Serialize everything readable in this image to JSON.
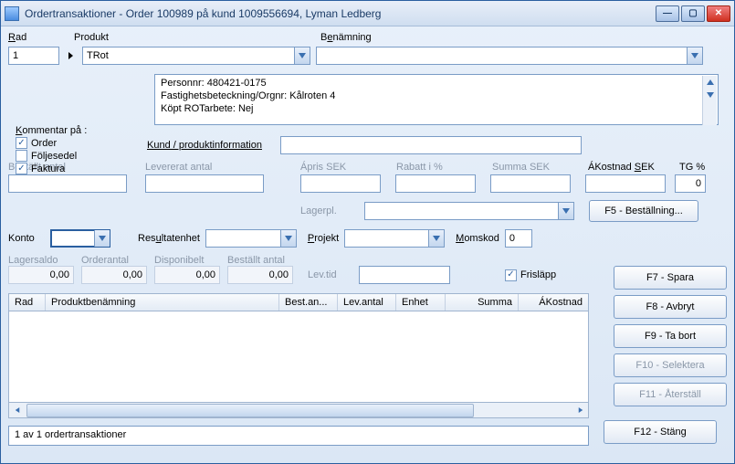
{
  "titlebar": {
    "title": "Ordertransaktioner - Order 100989 på kund 1009556694, Lyman Ledberg"
  },
  "labels": {
    "rad": "Rad",
    "produkt": "Produkt",
    "benamning": "Benämning",
    "kommentar": "Kommentar på :",
    "order": "Order",
    "foljesedel": "Följesedel",
    "faktura": "Faktura",
    "kund_info": "Kund / produktinformation",
    "bestallt_antal": "Beställt antal",
    "levererat_antal": "Levererat antal",
    "apris": "Ápris SEK",
    "rabatt": "Rabatt i %",
    "summa": "Summa SEK",
    "akostnad": "ÁKostnad SEK",
    "tg": "TG %",
    "lagerpl": "Lagerpl.",
    "konto": "Konto",
    "resultatenhet": "Resultatenhet",
    "projekt": "Projekt",
    "momskod": "Momskod",
    "lagersaldo": "Lagersaldo",
    "orderantal": "Orderantal",
    "disponibelt": "Disponibelt",
    "bestallt_antal2": "Beställt antal",
    "levtid": "Lev.tid",
    "frislapp": "Frisläpp"
  },
  "values": {
    "rad": "1",
    "produkt": "TRot",
    "benamning": "",
    "tg": "0",
    "momskod": "0",
    "lagersaldo": "0,00",
    "orderantal": "0,00",
    "disponibelt": "0,00",
    "bestallt_antal2": "0,00"
  },
  "info": {
    "l1": "Personnr: 480421-0175",
    "l2": "Fastighetsbeteckning/Orgnr: Kålroten 4",
    "l3": "Köpt ROTarbete: Nej"
  },
  "buttons": {
    "f5": "F5 - Beställning...",
    "f7": "F7 - Spara",
    "f8": "F8 - Avbryt",
    "f9": "F9 - Ta bort",
    "f10": "F10 - Selektera",
    "f11": "F11 - Återställ",
    "f12": "F12 - Stäng"
  },
  "grid": {
    "cols": [
      "Rad",
      "Produktbenämning",
      "Best.an...",
      "Lev.antal",
      "Enhet",
      "Summa",
      "ÁKostnad"
    ]
  },
  "status": "1 av 1 ordertransaktioner"
}
